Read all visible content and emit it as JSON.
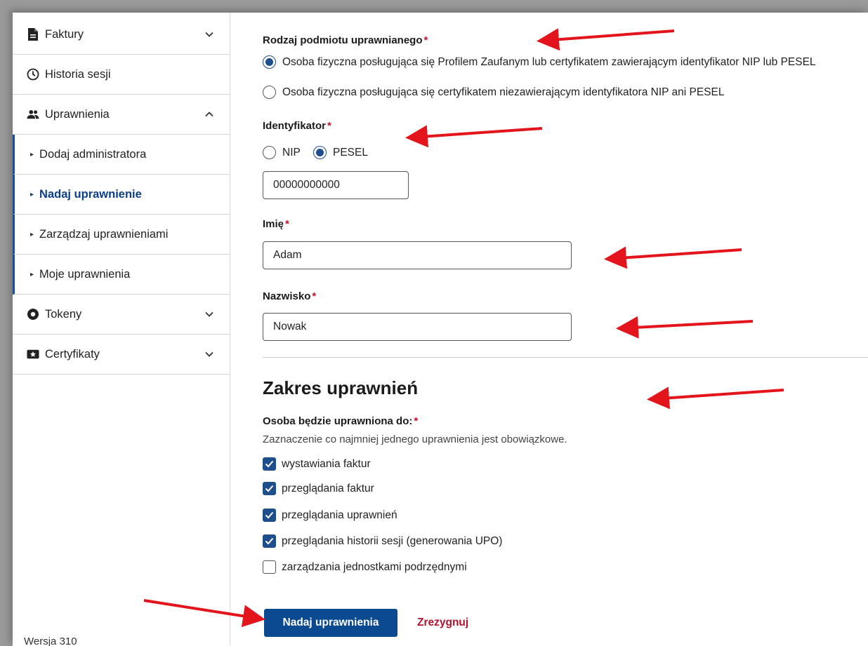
{
  "sidebar": {
    "items": [
      {
        "label": "Faktury",
        "icon": "document-icon",
        "expanded": false
      },
      {
        "label": "Historia sesji",
        "icon": "clock-icon"
      },
      {
        "label": "Uprawnienia",
        "icon": "users-icon",
        "expanded": true
      },
      {
        "label": "Tokeny",
        "icon": "token-icon",
        "expanded": false
      },
      {
        "label": "Certyfikaty",
        "icon": "certificate-icon",
        "expanded": false
      }
    ],
    "subitems": [
      {
        "label": "Dodaj administratora",
        "active": false
      },
      {
        "label": "Nadaj uprawnienie",
        "active": true
      },
      {
        "label": "Zarządzaj uprawnieniami",
        "active": false
      },
      {
        "label": "Moje uprawnienia",
        "active": false
      }
    ],
    "version": "Wersja 310"
  },
  "form": {
    "subject_type_label": "Rodzaj podmiotu uprawnianego",
    "subject_options": [
      {
        "label": "Osoba fizyczna posługująca się Profilem Zaufanym lub certyfikatem zawierającym identyfikator NIP lub PESEL",
        "selected": true
      },
      {
        "label": "Osoba fizyczna posługująca się certyfikatem niezawierającym identyfikatora NIP ani PESEL",
        "selected": false
      }
    ],
    "identifier_label": "Identyfikator",
    "identifier_options": [
      {
        "label": "NIP",
        "selected": false
      },
      {
        "label": "PESEL",
        "selected": true
      }
    ],
    "identifier_value": "00000000000",
    "first_name_label": "Imię",
    "first_name_value": "Adam",
    "last_name_label": "Nazwisko",
    "last_name_value": "Nowak",
    "required_mark": "*"
  },
  "scope": {
    "heading": "Zakres uprawnień",
    "label": "Osoba będzie uprawniona do:",
    "hint": "Zaznaczenie co najmniej jednego uprawnienia jest obowiązkowe.",
    "permissions": [
      {
        "label": "wystawiania faktur",
        "checked": true
      },
      {
        "label": "przeglądania faktur",
        "checked": true
      },
      {
        "label": "przeglądania uprawnień",
        "checked": true
      },
      {
        "label": "przeglądania historii sesji (generowania UPO)",
        "checked": true
      },
      {
        "label": "zarządzania jednostkami podrzędnymi",
        "checked": false
      }
    ]
  },
  "actions": {
    "submit_label": "Nadaj uprawnienia",
    "cancel_label": "Zrezygnuj"
  },
  "colors": {
    "accent": "#1f4e8c",
    "primary_button": "#0b4a91",
    "required": "#c8102e",
    "cancel": "#b3122b",
    "annotation_arrow": "#e3141b"
  }
}
